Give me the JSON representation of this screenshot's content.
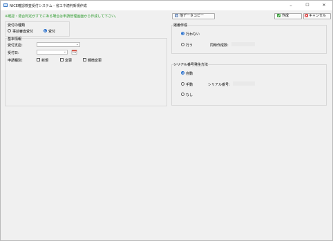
{
  "window": {
    "title": "NICE確認検査受付システム - 省エネ適判新規作成",
    "controls": {
      "minimize": "–",
      "maximize": "☐",
      "close": "✕"
    }
  },
  "notice": "※確認・適合判定がすでにある場合は申請管理画面から作成して下さい。",
  "toolbar": {
    "copy_label": "他データコピー",
    "create_label": "作成",
    "cancel_label": "キャンセル"
  },
  "reception_type": {
    "title": "受付の種類",
    "options": [
      {
        "label": "事前審査受付",
        "selected": false
      },
      {
        "label": "受付",
        "selected": true
      }
    ]
  },
  "basic_info": {
    "title": "基本情報",
    "office_label": "受付支店:",
    "office_value": "",
    "date_label": "受付日:",
    "date_value": "",
    "app_type_label": "申請種別:",
    "app_types": [
      {
        "label": "新規",
        "checked": false
      },
      {
        "label": "変更",
        "checked": false
      },
      {
        "label": "軽微変更",
        "checked": false
      }
    ]
  },
  "ledger": {
    "title": "運番作成",
    "options": [
      {
        "label": "行わない",
        "selected": true
      },
      {
        "label": "行う",
        "selected": false
      }
    ],
    "simultaneous_label": "同時作成数:",
    "simultaneous_value": ""
  },
  "serial": {
    "title": "シリアル番号発生方法",
    "options": [
      {
        "label": "自動",
        "selected": true
      },
      {
        "label": "手動",
        "selected": false
      },
      {
        "label": "なし",
        "selected": false
      }
    ],
    "serial_label": "シリアル番号:",
    "serial_value": ""
  },
  "colors": {
    "notice": "#2a9a2a",
    "radio_selected": "#1a66c9",
    "cancel_icon": "#d93636",
    "create_icon": "#3aa03a"
  }
}
